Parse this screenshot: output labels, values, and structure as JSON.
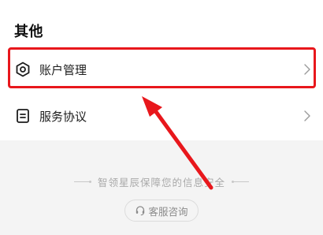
{
  "section": {
    "title": "其他"
  },
  "items": [
    {
      "label": "账户管理",
      "icon": "hexagon-settings-icon"
    },
    {
      "label": "服务协议",
      "icon": "document-icon"
    }
  ],
  "footer": {
    "tagline": "智领星辰保障您的信息安全",
    "service_button_label": "客服咨询",
    "service_icon": "headset-icon"
  },
  "colors": {
    "highlight": "#e8171c",
    "page_background": "#f4f4f4",
    "card_background": "#ffffff"
  }
}
